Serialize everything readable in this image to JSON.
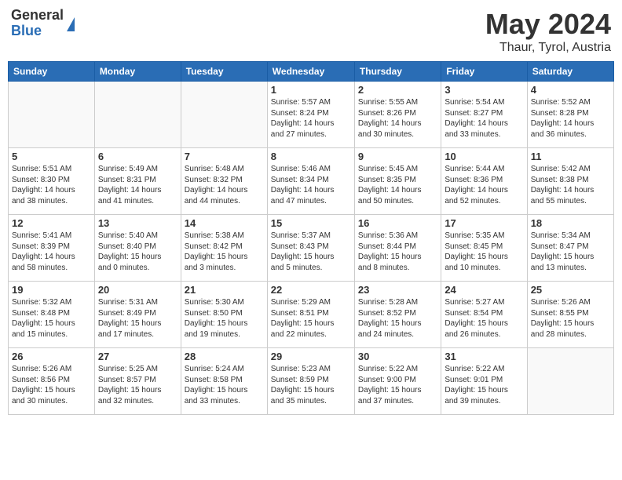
{
  "logo": {
    "general": "General",
    "blue": "Blue"
  },
  "header": {
    "month": "May 2024",
    "location": "Thaur, Tyrol, Austria"
  },
  "weekdays": [
    "Sunday",
    "Monday",
    "Tuesday",
    "Wednesday",
    "Thursday",
    "Friday",
    "Saturday"
  ],
  "weeks": [
    [
      {
        "day": "",
        "info": ""
      },
      {
        "day": "",
        "info": ""
      },
      {
        "day": "",
        "info": ""
      },
      {
        "day": "1",
        "info": "Sunrise: 5:57 AM\nSunset: 8:24 PM\nDaylight: 14 hours\nand 27 minutes."
      },
      {
        "day": "2",
        "info": "Sunrise: 5:55 AM\nSunset: 8:26 PM\nDaylight: 14 hours\nand 30 minutes."
      },
      {
        "day": "3",
        "info": "Sunrise: 5:54 AM\nSunset: 8:27 PM\nDaylight: 14 hours\nand 33 minutes."
      },
      {
        "day": "4",
        "info": "Sunrise: 5:52 AM\nSunset: 8:28 PM\nDaylight: 14 hours\nand 36 minutes."
      }
    ],
    [
      {
        "day": "5",
        "info": "Sunrise: 5:51 AM\nSunset: 8:30 PM\nDaylight: 14 hours\nand 38 minutes."
      },
      {
        "day": "6",
        "info": "Sunrise: 5:49 AM\nSunset: 8:31 PM\nDaylight: 14 hours\nand 41 minutes."
      },
      {
        "day": "7",
        "info": "Sunrise: 5:48 AM\nSunset: 8:32 PM\nDaylight: 14 hours\nand 44 minutes."
      },
      {
        "day": "8",
        "info": "Sunrise: 5:46 AM\nSunset: 8:34 PM\nDaylight: 14 hours\nand 47 minutes."
      },
      {
        "day": "9",
        "info": "Sunrise: 5:45 AM\nSunset: 8:35 PM\nDaylight: 14 hours\nand 50 minutes."
      },
      {
        "day": "10",
        "info": "Sunrise: 5:44 AM\nSunset: 8:36 PM\nDaylight: 14 hours\nand 52 minutes."
      },
      {
        "day": "11",
        "info": "Sunrise: 5:42 AM\nSunset: 8:38 PM\nDaylight: 14 hours\nand 55 minutes."
      }
    ],
    [
      {
        "day": "12",
        "info": "Sunrise: 5:41 AM\nSunset: 8:39 PM\nDaylight: 14 hours\nand 58 minutes."
      },
      {
        "day": "13",
        "info": "Sunrise: 5:40 AM\nSunset: 8:40 PM\nDaylight: 15 hours\nand 0 minutes."
      },
      {
        "day": "14",
        "info": "Sunrise: 5:38 AM\nSunset: 8:42 PM\nDaylight: 15 hours\nand 3 minutes."
      },
      {
        "day": "15",
        "info": "Sunrise: 5:37 AM\nSunset: 8:43 PM\nDaylight: 15 hours\nand 5 minutes."
      },
      {
        "day": "16",
        "info": "Sunrise: 5:36 AM\nSunset: 8:44 PM\nDaylight: 15 hours\nand 8 minutes."
      },
      {
        "day": "17",
        "info": "Sunrise: 5:35 AM\nSunset: 8:45 PM\nDaylight: 15 hours\nand 10 minutes."
      },
      {
        "day": "18",
        "info": "Sunrise: 5:34 AM\nSunset: 8:47 PM\nDaylight: 15 hours\nand 13 minutes."
      }
    ],
    [
      {
        "day": "19",
        "info": "Sunrise: 5:32 AM\nSunset: 8:48 PM\nDaylight: 15 hours\nand 15 minutes."
      },
      {
        "day": "20",
        "info": "Sunrise: 5:31 AM\nSunset: 8:49 PM\nDaylight: 15 hours\nand 17 minutes."
      },
      {
        "day": "21",
        "info": "Sunrise: 5:30 AM\nSunset: 8:50 PM\nDaylight: 15 hours\nand 19 minutes."
      },
      {
        "day": "22",
        "info": "Sunrise: 5:29 AM\nSunset: 8:51 PM\nDaylight: 15 hours\nand 22 minutes."
      },
      {
        "day": "23",
        "info": "Sunrise: 5:28 AM\nSunset: 8:52 PM\nDaylight: 15 hours\nand 24 minutes."
      },
      {
        "day": "24",
        "info": "Sunrise: 5:27 AM\nSunset: 8:54 PM\nDaylight: 15 hours\nand 26 minutes."
      },
      {
        "day": "25",
        "info": "Sunrise: 5:26 AM\nSunset: 8:55 PM\nDaylight: 15 hours\nand 28 minutes."
      }
    ],
    [
      {
        "day": "26",
        "info": "Sunrise: 5:26 AM\nSunset: 8:56 PM\nDaylight: 15 hours\nand 30 minutes."
      },
      {
        "day": "27",
        "info": "Sunrise: 5:25 AM\nSunset: 8:57 PM\nDaylight: 15 hours\nand 32 minutes."
      },
      {
        "day": "28",
        "info": "Sunrise: 5:24 AM\nSunset: 8:58 PM\nDaylight: 15 hours\nand 33 minutes."
      },
      {
        "day": "29",
        "info": "Sunrise: 5:23 AM\nSunset: 8:59 PM\nDaylight: 15 hours\nand 35 minutes."
      },
      {
        "day": "30",
        "info": "Sunrise: 5:22 AM\nSunset: 9:00 PM\nDaylight: 15 hours\nand 37 minutes."
      },
      {
        "day": "31",
        "info": "Sunrise: 5:22 AM\nSunset: 9:01 PM\nDaylight: 15 hours\nand 39 minutes."
      },
      {
        "day": "",
        "info": ""
      }
    ]
  ]
}
